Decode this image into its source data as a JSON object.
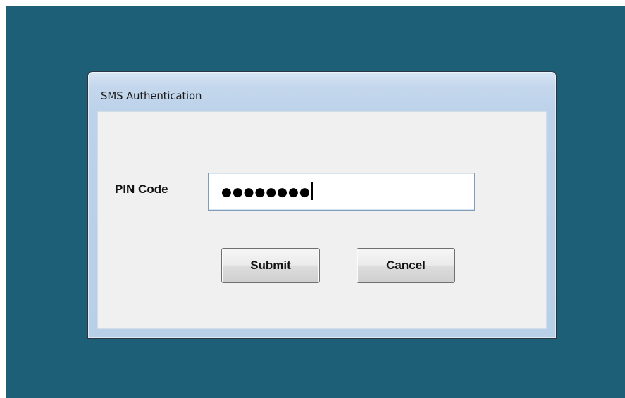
{
  "window": {
    "title": "SMS Authentication"
  },
  "form": {
    "pin_label": "PIN Code",
    "pin_value_masked": "●●●●●●●●",
    "submit_label": "Submit",
    "cancel_label": "Cancel"
  },
  "colors": {
    "desktop_background": "#1e5f78",
    "window_frame": "#bcd2ea",
    "client_background": "#f0f0f0"
  }
}
